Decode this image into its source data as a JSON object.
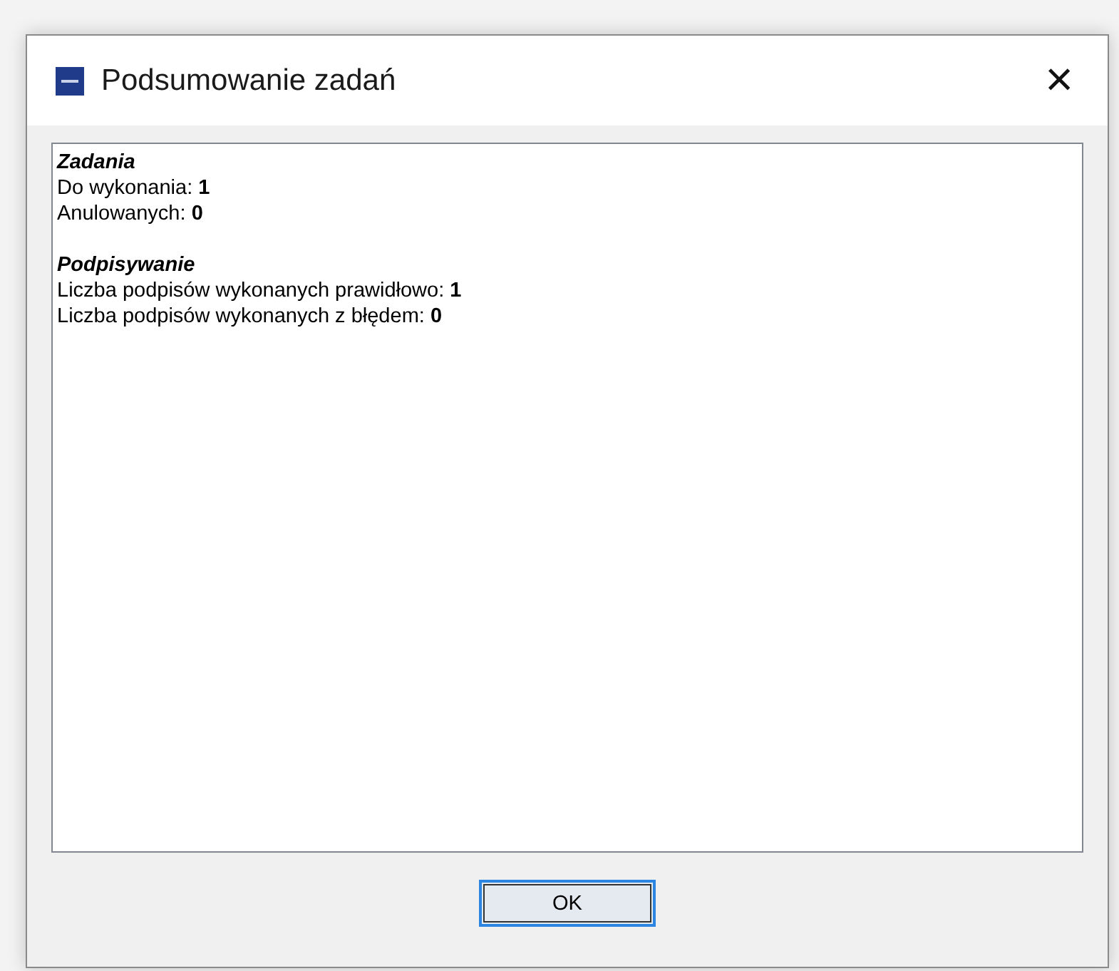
{
  "window": {
    "title": "Podsumowanie zadań",
    "close": "×"
  },
  "summary": [
    {
      "heading": "Zadania",
      "lines": [
        {
          "label": "Do wykonania:",
          "value": "1"
        },
        {
          "label": "Anulowanych:",
          "value": "0"
        }
      ]
    },
    {
      "heading": "Podpisywanie",
      "lines": [
        {
          "label": "Liczba podpisów wykonanych prawidłowo:",
          "value": "1"
        },
        {
          "label": "Liczba podpisów wykonanych z błędem:",
          "value": "0"
        }
      ]
    }
  ],
  "buttons": [
    {
      "label": "OK",
      "selected": true
    }
  ]
}
